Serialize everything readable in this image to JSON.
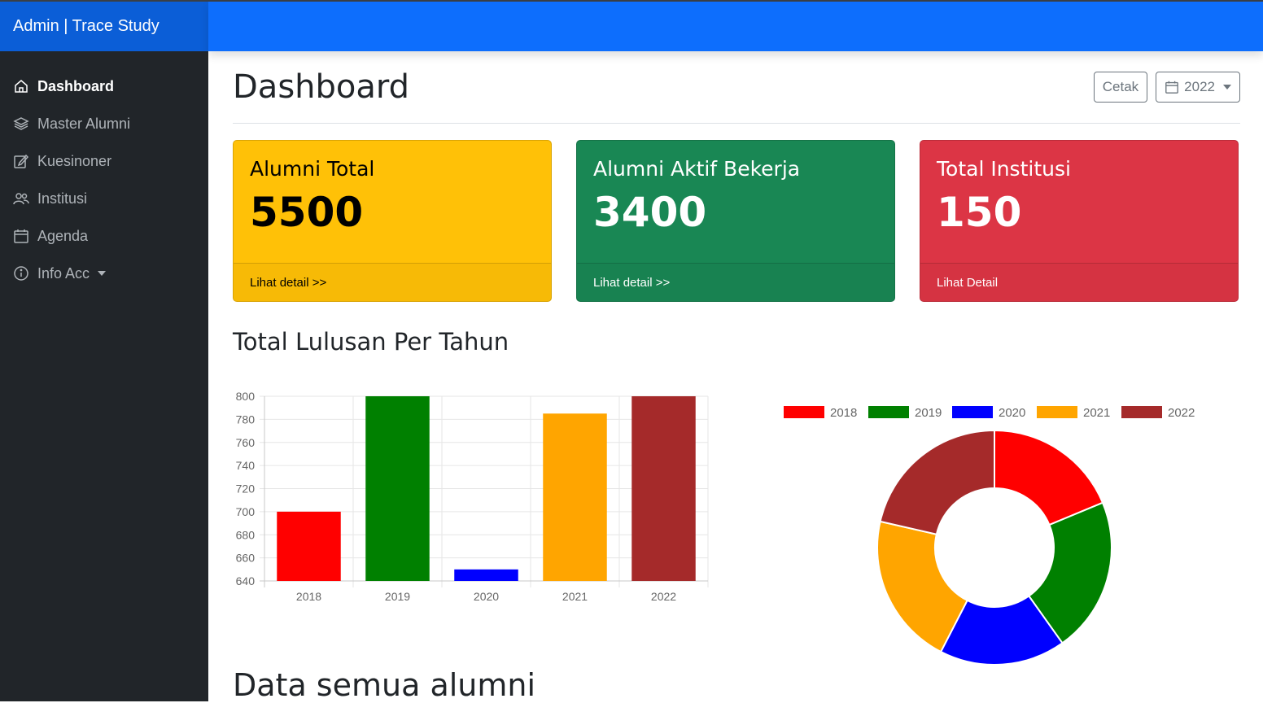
{
  "brand": "Admin | Trace Study",
  "sidebar": {
    "items": [
      {
        "label": "Dashboard",
        "icon": "home-icon"
      },
      {
        "label": "Master Alumni",
        "icon": "layers-icon"
      },
      {
        "label": "Kuesinoner",
        "icon": "edit-icon"
      },
      {
        "label": "Institusi",
        "icon": "people-icon"
      },
      {
        "label": "Agenda",
        "icon": "calendar-icon"
      },
      {
        "label": "Info Acc",
        "icon": "info-icon"
      }
    ]
  },
  "header": {
    "title": "Dashboard",
    "print_label": "Cetak",
    "year_label": "2022"
  },
  "cards": [
    {
      "title": "Alumni Total",
      "value": "5500",
      "link": "Lihat detail >>"
    },
    {
      "title": "Alumni Aktif Bekerja",
      "value": "3400",
      "link": "Lihat detail >>"
    },
    {
      "title": "Total Institusi",
      "value": "150",
      "link": "Lihat Detail"
    }
  ],
  "section_title": "Total Lulusan Per Tahun",
  "bottom_title": "Data semua alumni",
  "colors": {
    "2018": "#ff0000",
    "2019": "#008000",
    "2020": "#0000ff",
    "2021": "#ffa500",
    "2022": "#a52a2a"
  },
  "chart_data": [
    {
      "type": "bar",
      "categories": [
        "2018",
        "2019",
        "2020",
        "2021",
        "2022"
      ],
      "values": [
        700,
        800,
        650,
        785,
        800
      ],
      "ylim": [
        640,
        800
      ],
      "yticks": [
        640,
        660,
        680,
        700,
        720,
        740,
        760,
        780,
        800
      ],
      "grid": true,
      "legend": "none"
    },
    {
      "type": "pie",
      "labels": [
        "2018",
        "2019",
        "2020",
        "2021",
        "2022"
      ],
      "values": [
        700,
        800,
        650,
        785,
        800
      ],
      "legend": "top"
    }
  ]
}
